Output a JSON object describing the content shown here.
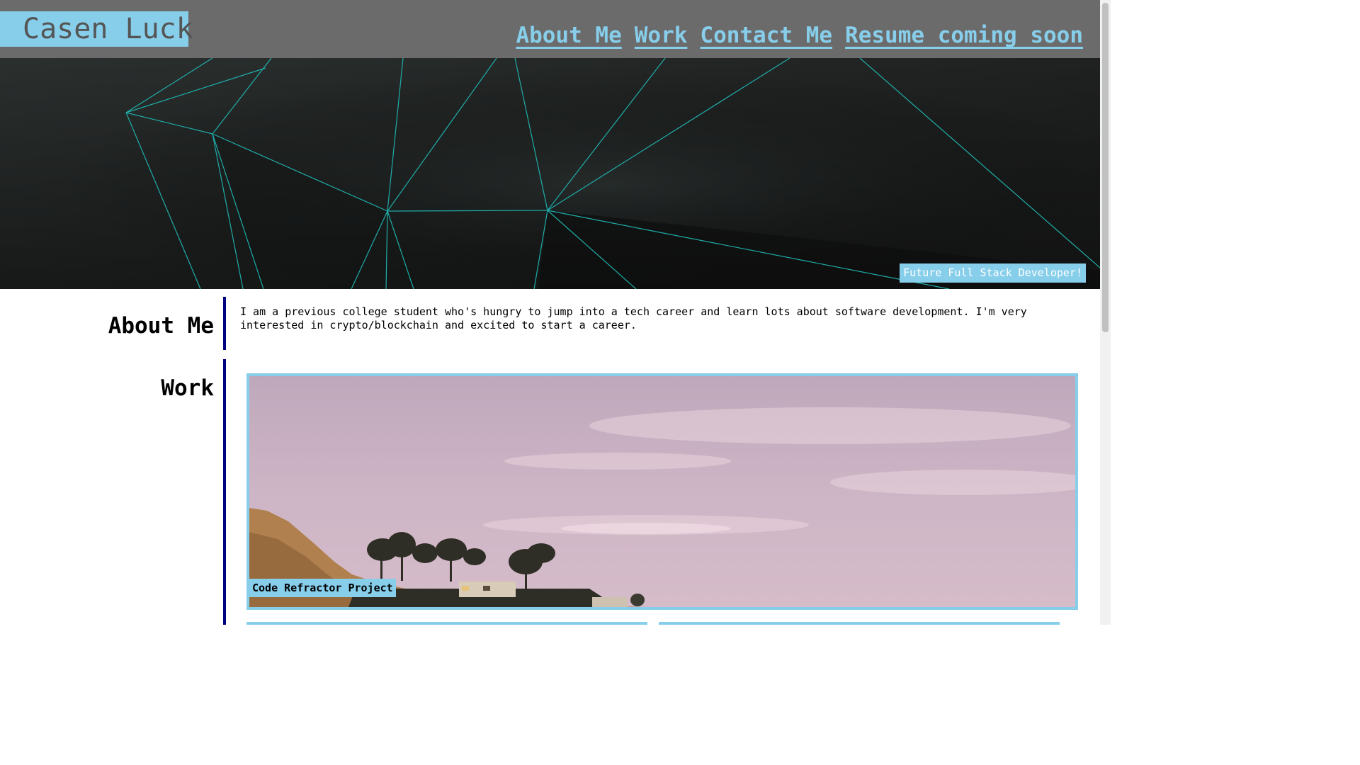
{
  "header": {
    "site_title": "Casen Luck",
    "nav": [
      "About Me",
      "Work",
      "Contact Me",
      "Resume coming soon"
    ]
  },
  "hero": {
    "tagline": "Future Full Stack Developer!"
  },
  "about": {
    "heading": "About Me",
    "text": "I am a previous college student who's hungry to jump into a tech career and learn lots about software development. I'm very interested in crypto/blockchain and excited to start a career."
  },
  "work": {
    "heading": "Work",
    "projects": [
      {
        "label": "Code Refractor Project"
      }
    ]
  },
  "colors": {
    "header_bg": "#6b6b6b",
    "accent": "#87ceeb",
    "divider": "#000080"
  }
}
